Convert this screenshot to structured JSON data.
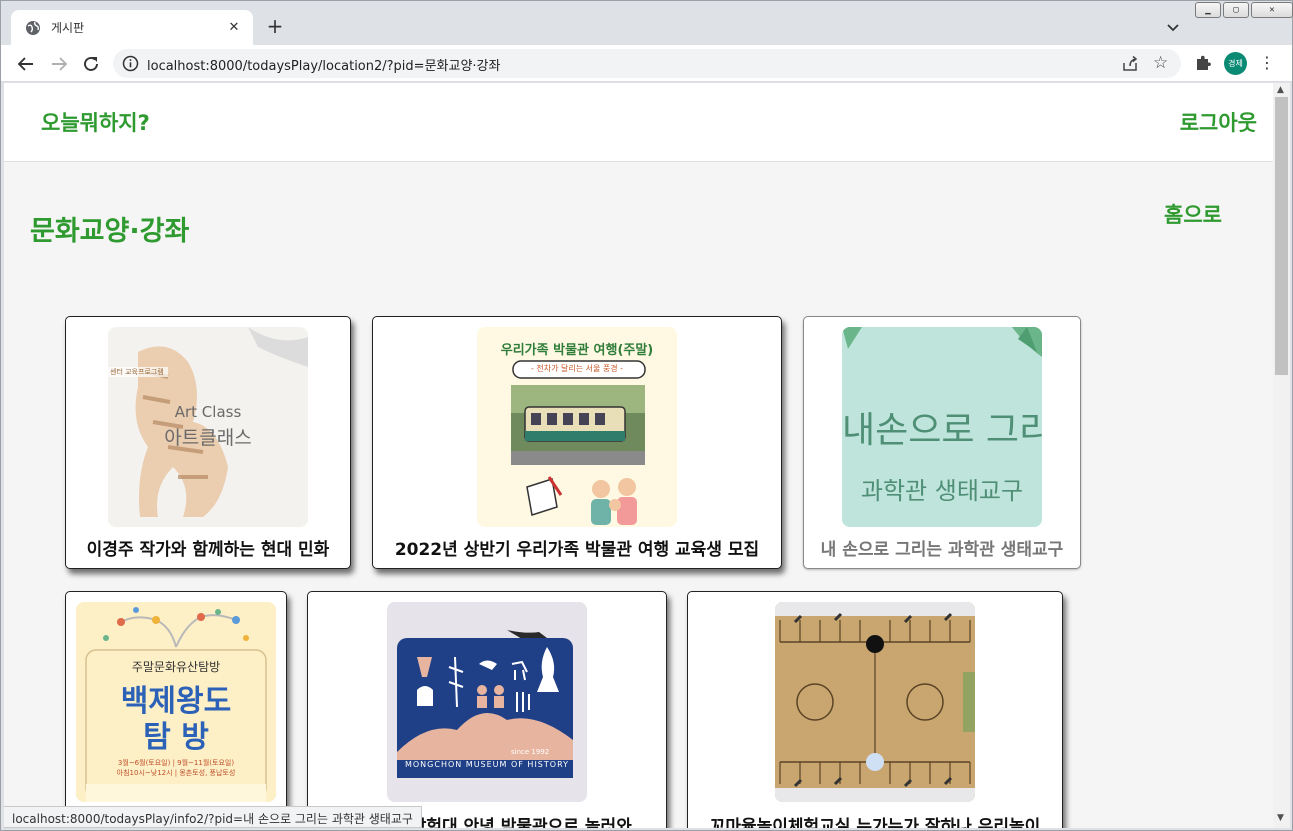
{
  "browser": {
    "tab_title": "게시판",
    "url": "localhost:8000/todaysPlay/location2/?pid=문화교양·강좌",
    "profile_label": "경제",
    "status_url": "localhost:8000/todaysPlay/info2/?pid=내 손으로 그리는 과학관 생태교구",
    "colors": {
      "tabstrip": "#dee1e6",
      "omnibox": "#f1f3f4",
      "profile": "#0b8a74"
    }
  },
  "site": {
    "brand": "오늘뭐하지?",
    "logout_label": "로그아웃",
    "accent_color": "#2f9a2f"
  },
  "page": {
    "title": "문화교양·강좌",
    "home_label": "홈으로"
  },
  "cards": [
    {
      "caption": "이경주 작가와 함께하는 현대 민화",
      "thumb_lines": [
        "센터 교육프로그램",
        "Art Class",
        "아트클래스"
      ]
    },
    {
      "caption": "2022년 상반기 우리가족 박물관 여행 교육생 모집",
      "thumb_lines": [
        "우리가족 박물관 여행(주말)",
        "- 전차가 달리는 서울 풍경 -"
      ]
    },
    {
      "caption": "내 손으로 그리는 과학관 생태교구",
      "thumb_lines": [
        "내손으로 그리",
        "과학관 생태교구"
      ]
    },
    {
      "caption": "",
      "thumb_lines": [
        "주말문화유산탐방",
        "백제왕도",
        "탐 방",
        "3월~6월(토요일) | 9월~11월(토요일)",
        "아침10시~낮12시 | 몽촌토성, 풍납토성"
      ]
    },
    {
      "caption": "한성백제 탐험대 안녕 박물관으로 놀러와",
      "thumb_lines": [
        "since 1992",
        "MONGCHON MUSEUM OF HISTORY"
      ]
    },
    {
      "caption": "꼬마윷놀이체험교실 누가누가 잘하나 우리놀이",
      "thumb_lines": []
    }
  ]
}
